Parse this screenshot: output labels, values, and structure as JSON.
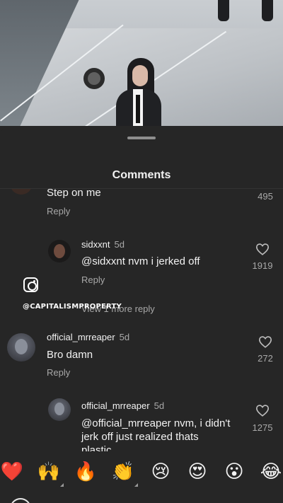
{
  "sheet": {
    "title": "Comments"
  },
  "comments": [
    {
      "username": "",
      "time": "",
      "text": "Step on me",
      "reply_label": "Reply",
      "likes": "495"
    },
    {
      "username": "sidxxnt",
      "time": "5d",
      "text": "@sidxxnt nvm i jerked off",
      "reply_label": "Reply",
      "likes": "1919"
    },
    {
      "view_more": "View 1 more reply"
    },
    {
      "username": "official_mrreaper",
      "time": "5d",
      "text": "Bro damn",
      "reply_label": "Reply",
      "likes": "272"
    },
    {
      "username": "official_mrreaper",
      "time": "5d",
      "text_line1": "@official_mrreaper nvm, i didn't",
      "text_line2": "jerk off just realized thats",
      "text_line3": "plastic",
      "likes": "1275"
    }
  ],
  "watermark": {
    "icon": "instagram-icon",
    "text": "@CAPITALISMPROPERTY"
  },
  "emoji_bar": [
    {
      "emoji": "❤️",
      "name": "red-heart-emoji"
    },
    {
      "emoji": "🙌",
      "name": "raised-hands-emoji"
    },
    {
      "emoji": "🔥",
      "name": "fire-emoji"
    },
    {
      "emoji": "👏",
      "name": "clapping-hands-emoji"
    },
    {
      "emoji": "😢",
      "name": "crying-face-emoji"
    },
    {
      "emoji": "😍",
      "name": "heart-eyes-emoji"
    },
    {
      "emoji": "😮",
      "name": "surprised-face-emoji"
    },
    {
      "emoji": "😂",
      "name": "tears-of-joy-emoji"
    }
  ],
  "colors": {
    "sheet_bg": "#262626",
    "secondary_text": "#a8a8a8",
    "primary_text": "#f2f2f2"
  }
}
